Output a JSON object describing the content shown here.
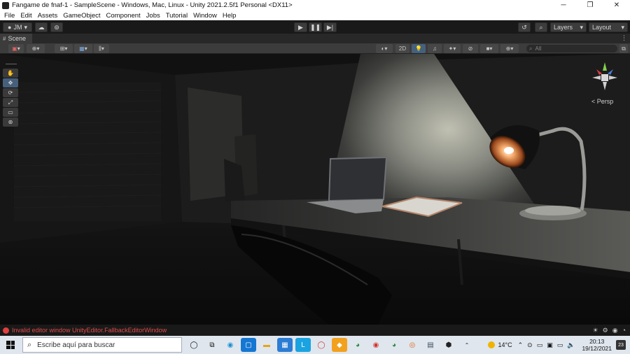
{
  "window": {
    "title": "Fangame de fnaf-1 - SampleScene - Windows, Mac, Linux - Unity 2021.2.5f1 Personal <DX11>",
    "minimize": "─",
    "maximize": "❐",
    "close": "✕"
  },
  "menu": [
    "File",
    "Edit",
    "Assets",
    "GameObject",
    "Component",
    "Jobs",
    "Tutorial",
    "Window",
    "Help"
  ],
  "toolbar": {
    "account_label": "JM",
    "layers_label": "Layers",
    "layout_label": "Layout",
    "play_icon": "▶",
    "pause_icon": "❚❚",
    "step_icon": "▶|"
  },
  "scene": {
    "tab_label": "Scene",
    "toggle_2d_label": "2D",
    "search_placeholder": "All",
    "persp_label": "< Persp",
    "tools": [
      "hand-tool-icon",
      "move-tool-icon",
      "rotate-tool-icon",
      "scale-tool-icon",
      "rect-tool-icon",
      "transform-tool-icon"
    ]
  },
  "status": {
    "message": "Invalid editor window UnityEditor.FallbackEditorWindow"
  },
  "taskbar": {
    "search_placeholder": "Escribe aquí para buscar",
    "temperature": "14°C",
    "time": "20:13",
    "date": "19/12/2021",
    "notifications": "23"
  },
  "colors": {
    "editor_bg": "#191919",
    "panel": "#3c3c3c",
    "error": "#e04b4b",
    "taskbar": "#dfe6ee",
    "lamp_glow": "#f5a96a"
  }
}
